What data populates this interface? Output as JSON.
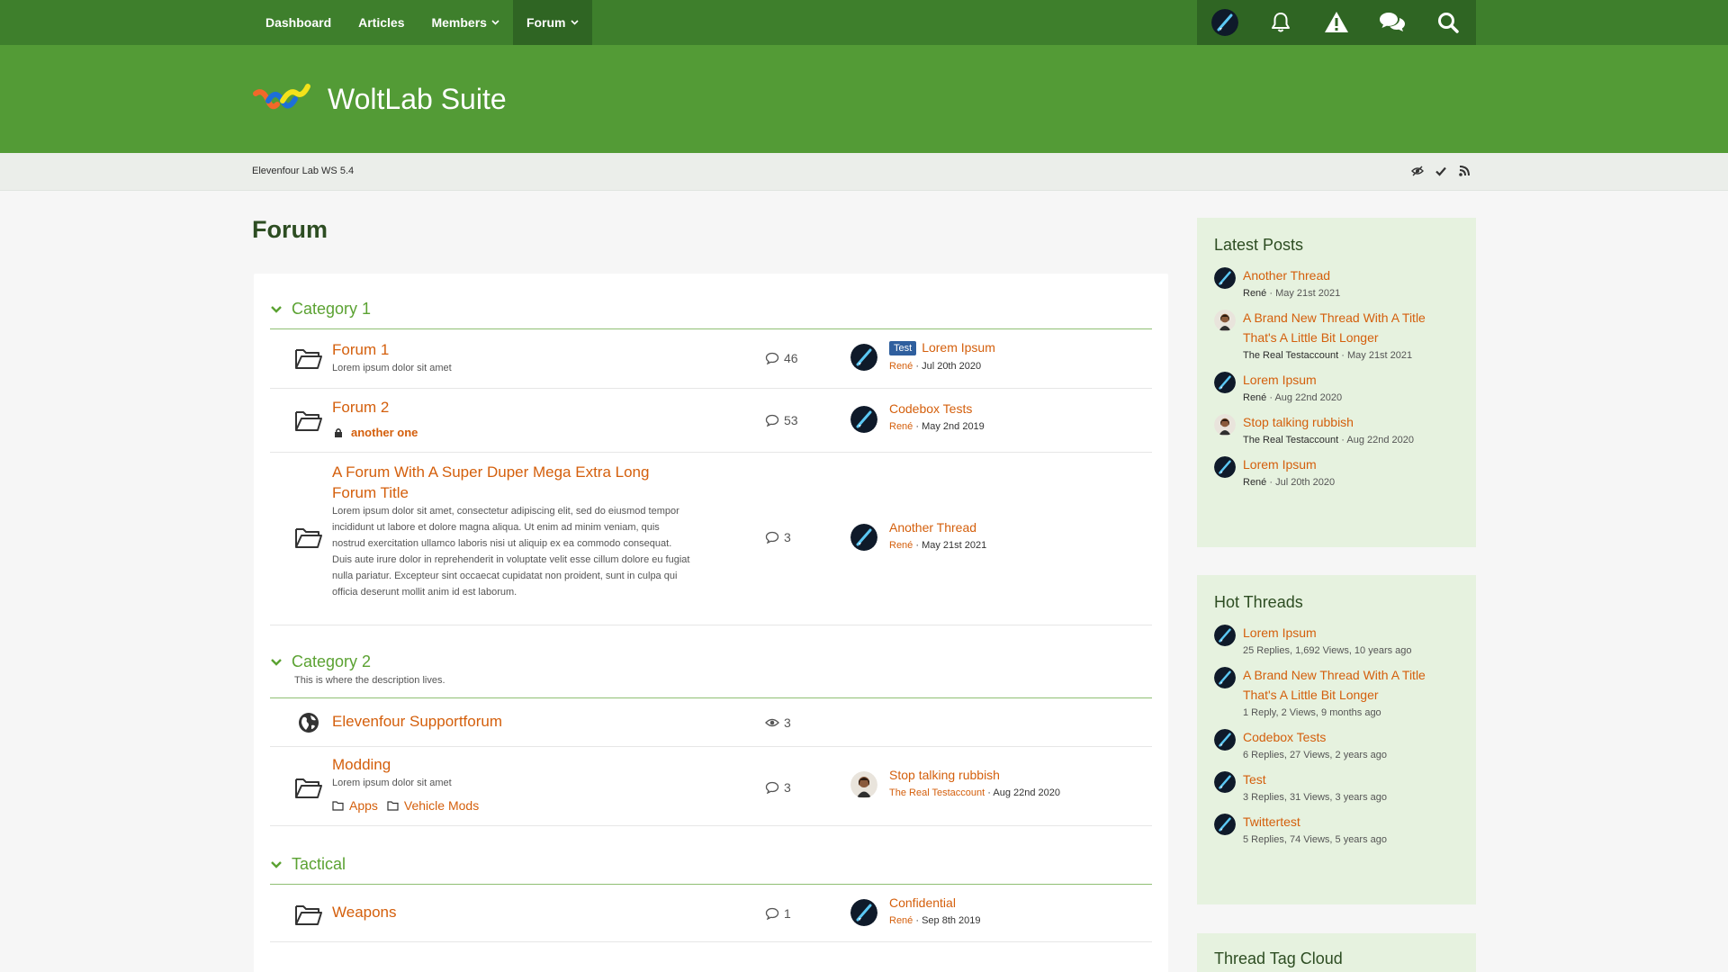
{
  "nav": {
    "items": [
      {
        "label": "Dashboard"
      },
      {
        "label": "Articles"
      },
      {
        "label": "Members"
      },
      {
        "label": "Forum"
      }
    ]
  },
  "header": {
    "logo_text": "WoltLab Suite"
  },
  "breadcrumb": {
    "label": "Elevenfour Lab WS 5.4"
  },
  "page": {
    "title": "Forum"
  },
  "categories": [
    {
      "title": "Category 1",
      "description": ""
    },
    {
      "title": "Category 2",
      "description": "This is where the description lives."
    },
    {
      "title": "Tactical",
      "description": ""
    }
  ],
  "forums": [
    {
      "name": "Forum 1",
      "description": "Lorem ipsum dolor sit amet",
      "count": "46",
      "last_label": "Test",
      "last_title": "Lorem Ipsum",
      "last_user": "René",
      "last_date": "Jul 20th 2020"
    },
    {
      "name": "Forum 2",
      "sub": "another one",
      "count": "53",
      "last_title": "Codebox Tests",
      "last_user": "René",
      "last_date": "May 2nd 2019"
    },
    {
      "name": "A Forum With A Super Duper Mega Extra Long Forum Title",
      "description": "Lorem ipsum dolor sit amet, consectetur adipiscing elit, sed do eiusmod tempor incididunt ut labore et dolore magna aliqua. Ut enim ad minim veniam, quis nostrud exercitation ullamco laboris nisi ut aliquip ex ea commodo consequat. Duis aute irure dolor in reprehenderit in voluptate velit esse cillum dolore eu fugiat nulla pariatur. Excepteur sint occaecat cupidatat non proident, sunt in culpa qui officia deserunt mollit anim id est laborum.",
      "count": "3",
      "last_title": "Another Thread",
      "last_user": "René",
      "last_date": "May 21st 2021"
    },
    {
      "name": "Elevenfour Supportforum",
      "count": "3"
    },
    {
      "name": "Modding",
      "description": "Lorem ipsum dolor sit amet",
      "subforums": [
        "Apps",
        "Vehicle Mods"
      ],
      "count": "3",
      "last_title": "Stop talking rubbish",
      "last_user": "The Real Testaccount",
      "last_date": "Aug 22nd 2020"
    },
    {
      "name": "Weapons",
      "count": "1",
      "last_title": "Confidential",
      "last_user": "René",
      "last_date": "Sep 8th 2019"
    }
  ],
  "sidebar": {
    "latest": {
      "title": "Latest Posts",
      "items": [
        {
          "title": "Another Thread",
          "user": "René",
          "date": "May 21st 2021"
        },
        {
          "title": "A Brand New Thread With A Title That's A Little Bit Longer",
          "user": "The Real Testaccount",
          "date": "May 21st 2021"
        },
        {
          "title": "Lorem Ipsum",
          "user": "René",
          "date": "Aug 22nd 2020"
        },
        {
          "title": "Stop talking rubbish",
          "user": "The Real Testaccount",
          "date": "Aug 22nd 2020"
        },
        {
          "title": "Lorem Ipsum",
          "user": "René",
          "date": "Jul 20th 2020"
        }
      ]
    },
    "hot": {
      "title": "Hot Threads",
      "items": [
        {
          "title": "Lorem Ipsum",
          "meta": "25 Replies, 1,692 Views, 10 years ago"
        },
        {
          "title": "A Brand New Thread With A Title That's A Little Bit Longer",
          "meta": "1 Reply, 2 Views, 9 months ago"
        },
        {
          "title": "Codebox Tests",
          "meta": "6 Replies, 27 Views, 2 years ago"
        },
        {
          "title": "Test",
          "meta": "3 Replies, 31 Views, 3 years ago"
        },
        {
          "title": "Twittertest",
          "meta": "5 Replies, 74 Views, 5 years ago"
        }
      ]
    },
    "tagcloud": {
      "title": "Thread Tag Cloud"
    }
  },
  "meta_separator": " · ",
  "colors": {
    "accent": "#d45f0c",
    "nav": "#3e7f2c",
    "header": "#539b36",
    "category": "#5ba232"
  }
}
